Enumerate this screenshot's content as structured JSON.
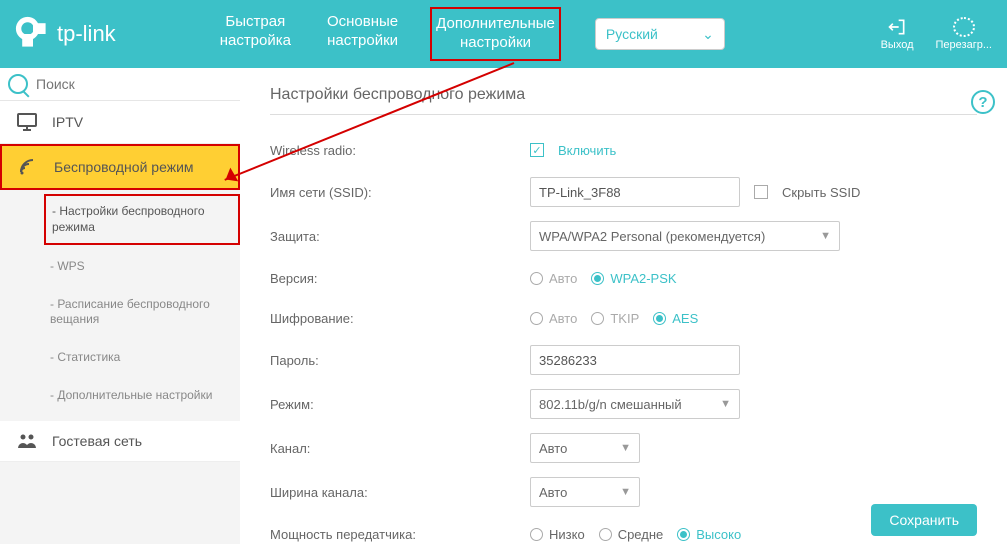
{
  "brand": "tp-link",
  "nav": {
    "item1a": "Быстрая",
    "item1b": "настройка",
    "item2a": "Основные",
    "item2b": "настройки",
    "item3a": "Дополнительные",
    "item3b": "настройки"
  },
  "language": "Русский",
  "header_actions": {
    "logout": "Выход",
    "reboot": "Перезагр..."
  },
  "search": {
    "placeholder": "Поиск"
  },
  "sidebar": {
    "iptv": "IPTV",
    "wireless": "Беспроводной режим",
    "sub": {
      "wireless_settings": "- Настройки беспроводного режима",
      "wps": "- WPS",
      "schedule": "- Расписание беспроводного вещания",
      "stats": "- Статистика",
      "advanced": "- Дополнительные настройки"
    },
    "guest": "Гостевая сеть"
  },
  "page": {
    "title": "Настройки беспроводного режима"
  },
  "form": {
    "wireless_radio": {
      "label": "Wireless radio:",
      "enable": "Включить"
    },
    "ssid": {
      "label": "Имя сети (SSID):",
      "value": "TP-Link_3F88",
      "hide": "Скрыть SSID"
    },
    "security": {
      "label": "Защита:",
      "value": "WPA/WPA2 Personal (рекомендуется)"
    },
    "version": {
      "label": "Версия:",
      "auto": "Авто",
      "wpa2psk": "WPA2-PSK"
    },
    "encryption": {
      "label": "Шифрование:",
      "auto": "Авто",
      "tkip": "TKIP",
      "aes": "AES"
    },
    "password": {
      "label": "Пароль:",
      "value": "35286233"
    },
    "mode": {
      "label": "Режим:",
      "value": "802.11b/g/n смешанный"
    },
    "channel": {
      "label": "Канал:",
      "value": "Авто"
    },
    "width": {
      "label": "Ширина канала:",
      "value": "Авто"
    },
    "txpower": {
      "label": "Мощность передатчика:",
      "low": "Низко",
      "mid": "Средне",
      "high": "Высоко"
    }
  },
  "save": "Сохранить"
}
